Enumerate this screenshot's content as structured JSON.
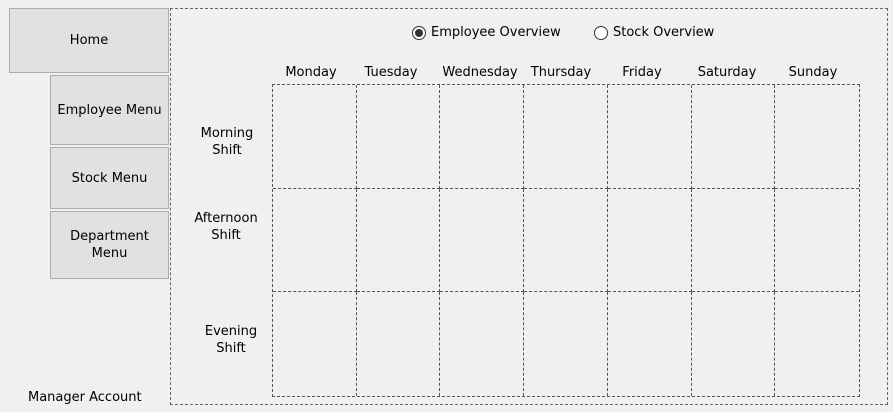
{
  "nav": {
    "home": "Home",
    "employee_menu": "Employee Menu",
    "stock_menu": "Stock Menu",
    "department_menu": "Department\nMenu"
  },
  "account_label": "Manager Account",
  "overview": {
    "employee_label": "Employee Overview",
    "stock_label": "Stock Overview",
    "selected": "employee"
  },
  "schedule": {
    "days": [
      "Monday",
      "Tuesday",
      "Wednesday",
      "Thursday",
      "Friday",
      "Saturday",
      "Sunday"
    ],
    "shifts": [
      "Morning\nShift",
      "Afternoon\nShift",
      "Evening\nShift"
    ]
  }
}
